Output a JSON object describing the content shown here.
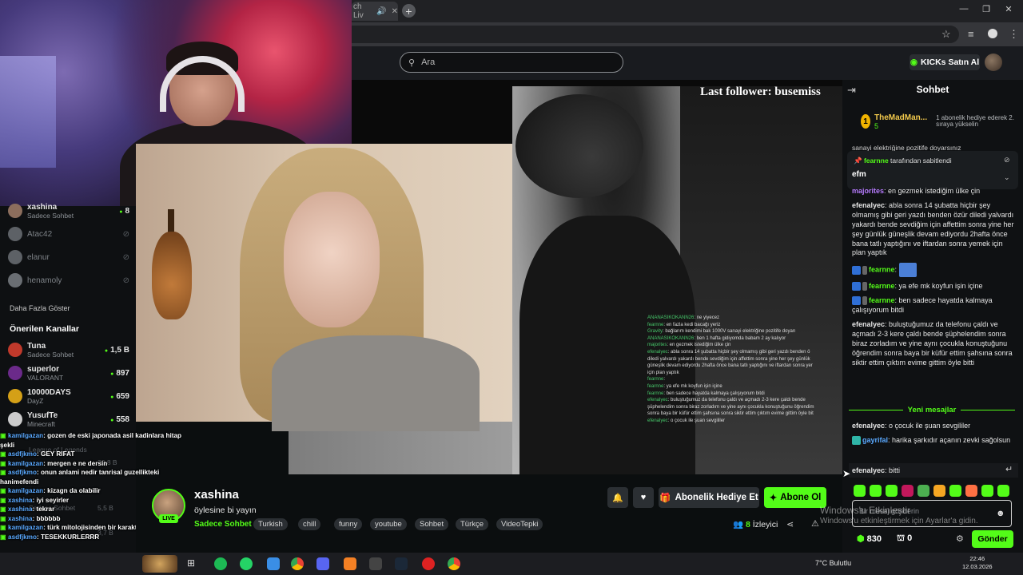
{
  "browser": {
    "tab_title": "ch Liv",
    "tab_close": "✕",
    "new_tab": "+"
  },
  "header": {
    "search_placeholder": "Ara",
    "kicks_button": "KICKs Satın Al"
  },
  "overlay": {
    "last_follower": "Last follower: busemiss",
    "chat": [
      {
        "name": "ANANASIKOKANN26",
        "text": ": ne yiyecez"
      },
      {
        "name": "fearnne",
        "text": ": en fazla kedi bacağı yeriz"
      },
      {
        "name": "Gravity",
        "text": ": bağlarım kendimi bak 1000V sanayi elektriğine pozitife doyarı"
      },
      {
        "name": "ANANASIKOKANN26",
        "text": ": ben 1 hafta gidiyomda babam 2 ay kalıyor"
      },
      {
        "name": "majorites",
        "text": ": en gezmek istediğim ülke çin"
      },
      {
        "name": "efenalyec",
        "text": ": abla sonra 14 şubatta hiçbir şey olmamış gibi geri yazdı benden ö"
      },
      {
        "name": "",
        "text": "diledi yalvardı yakardı bende sevdiğim için affettim sonra yine her şey günlük"
      },
      {
        "name": "",
        "text": "güneşlik devam ediyordu 2hafta önce bana tatlı yaptığını ve iftardan sonra yer"
      },
      {
        "name": "",
        "text": "için plan yaptık"
      },
      {
        "name": "fearnne",
        "text": ":"
      },
      {
        "name": "fearnne",
        "text": ": ya efe mk koyfun işin içine"
      },
      {
        "name": "fearnne",
        "text": ": ben sadece hayatda kalmaya çalışıyorum bitdi"
      },
      {
        "name": "efenalyec",
        "text": ": buluştuğumuz da telefonu çaldı ve açmadı 2-3 kere çaldı bende"
      },
      {
        "name": "",
        "text": "şüphelendim sonra biraz zorladım ve yine aynı çocukla konuştuğunu öğrendim"
      },
      {
        "name": "",
        "text": "sonra baya bir küfür ettim şahsına sonra siktir ettim çıktım evime gittim öyle bit"
      },
      {
        "name": "efenalyec",
        "text": ": o çocuk ile şuan sevgililer"
      }
    ]
  },
  "sidebar": {
    "following": [
      {
        "name": "xashina",
        "sub": "Sadece Sohbet",
        "count": "8",
        "live": true
      },
      {
        "name": "Atac42",
        "sub": "",
        "count": "",
        "live": false
      },
      {
        "name": "elanur",
        "sub": "",
        "count": "",
        "live": false
      },
      {
        "name": "henamoly",
        "sub": "",
        "count": "",
        "live": false
      }
    ],
    "show_more": "Daha Fazla Göster",
    "recommended_title": "Önerilen Kanallar",
    "recommended": [
      {
        "name": "Tuna",
        "sub": "Sadece Sohbet",
        "count": "1,5 B"
      },
      {
        "name": "superlor",
        "sub": "VALORANT",
        "count": "897"
      },
      {
        "name": "10000DAYS",
        "sub": "DayZ",
        "count": "659"
      },
      {
        "name": "YusufTe",
        "sub": "Minecraft",
        "count": "558"
      }
    ]
  },
  "bottom_chat": [
    {
      "name": "kamilgazan",
      "text": ": gozen de eski japonada asil kadinlara hitap"
    },
    {
      "name": "",
      "text": "şekli"
    },
    {
      "name": "asdfjkmo",
      "text": ": GEY RIFAT"
    },
    {
      "name": "kamilgazan",
      "text": ": mergen e ne dersin"
    },
    {
      "name": "asdfjkmo",
      "text": ": onun anlami nedir tanrisal guzellikteki"
    },
    {
      "name": "",
      "text": "hanimefendi"
    },
    {
      "name": "kamilgazan",
      "text": ": kizagn da olabilir"
    },
    {
      "name": "xashina",
      "text": ": iyi seyirler"
    },
    {
      "name": "xashina",
      "text": ": tekrar"
    },
    {
      "name": "xashina",
      "text": ": bbbbbb"
    },
    {
      "name": "kamilgazan",
      "text": ": türk mitolojisinden bir karakter"
    },
    {
      "name": "asdfjkmo",
      "text": ": TESEKKURLERRR"
    }
  ],
  "bottom_ghost": [
    {
      "text": "League of Legends",
      "num": ""
    },
    {
      "text": "",
      "num": "20,8 B"
    },
    {
      "text": "Sadece Sohbet",
      "num": "5,5 B"
    },
    {
      "text": "",
      "num": "3,7 B"
    }
  ],
  "stream": {
    "streamer": "xashina",
    "live_badge": "LIVE",
    "title": "öylesine bi yayın",
    "category": "Sadece Sohbet",
    "tags": [
      "Turkish",
      "chill",
      "funny",
      "youtube",
      "Sohbet",
      "Türkçe",
      "VideoTepki"
    ],
    "gift_button": "Abonelik Hediye Et",
    "subscribe_button": "Abone Ol",
    "viewers_count": "8",
    "viewers_label": "İzleyici"
  },
  "chat": {
    "title": "Sohbet",
    "top_gifter": {
      "rank": "1",
      "name": "TheMadMan...",
      "count": "5",
      "note": "1 abonelik hediye ederek 2. sıraya yükselin"
    },
    "pinned_partial": "sanayi elektriğine pozitife doyarsınız",
    "pinned_by_user": "fearnne",
    "pinned_by_suffix": " tarafından sabitlendi",
    "pinned_message": "efm",
    "messages": [
      {
        "user": "majorites",
        "color": "#b77cff",
        "text": ": en gezmek istediğim ülke çin"
      },
      {
        "user": "efenalyec",
        "color": "#e6e6e6",
        "text": ": abla sonra 14 şubatta hiçbir şey olmamış gibi geri yazdı benden özür diledi yalvardı yakardı bende sevdiğim için affettim sonra yine her şey günlük güneşlik devam ediyordu 2hafta önce bana tatlı yaptığını ve iftardan sonra yemek için plan yaptık"
      },
      {
        "user": "fearnne",
        "color": "#53fc18",
        "text": ":"
      },
      {
        "user": "fearnne",
        "color": "#53fc18",
        "text": ": ya efe mk koyfun işin içine"
      },
      {
        "user": "fearnne",
        "color": "#53fc18",
        "text": ": ben sadece hayatda kalmaya çalışıyorum bitdi"
      },
      {
        "user": "efenalyec",
        "color": "#e6e6e6",
        "text": ": buluştuğumuz da telefonu çaldı ve açmadı 2-3 kere çaldı bende şüphelendim sonra biraz zorladım ve yine aynı çocukla konuştuğunu öğrendim sonra baya bir küfür ettim şahsına sonra siktir ettim çıktım evime gittim öyle bitti"
      }
    ],
    "new_messages_label": "Yeni mesajlar",
    "after": [
      {
        "user": "efenalyec",
        "color": "#e6e6e6",
        "text": ": o çocuk ile şuan sevgililer"
      },
      {
        "user": "gayrifal",
        "color": "#5aa9ff",
        "text": ": harika şarkıdır açanın zevki sağolsun"
      }
    ],
    "last": {
      "user": "efenalyec",
      "text": ": bitti"
    },
    "input_placeholder": "Bir mesaj gönderin",
    "points": "830",
    "other_count": "0",
    "send_button": "Gönder"
  },
  "watermark": {
    "line1": "Windows'u Etkinleştir",
    "line2": "Windows'u etkinleştirmek için Ayarlar'a gidin."
  },
  "taskbar": {
    "weather": "7°C  Bulutlu",
    "time": "22:46",
    "date": "12.03.2026"
  },
  "colors": {
    "accent": "#53fc18",
    "background": "#0b0e0f"
  }
}
